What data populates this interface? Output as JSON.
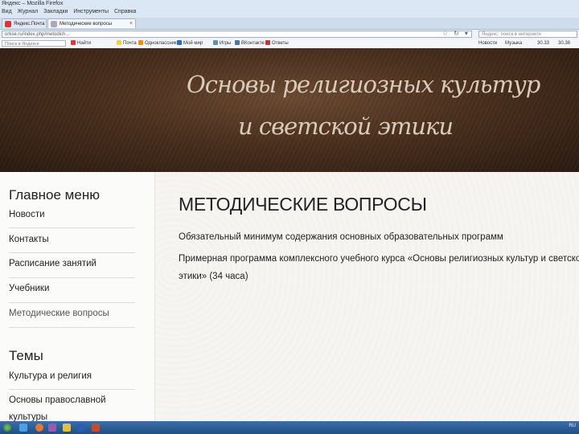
{
  "browser": {
    "window_title": "Яндекс – Mozilla Firefox",
    "menu": [
      "Вид",
      "Журнал",
      "Закладки",
      "Инструменты",
      "Справка"
    ],
    "tabs": [
      {
        "label": "Яндекс.Почта",
        "icon": "yandex-mail-icon",
        "active": false
      },
      {
        "label": "Методические вопросы",
        "icon": "page-icon",
        "active": true
      }
    ],
    "new_tab_label": "+",
    "url": "orkse.ru/index.php/metodich...",
    "search_placeholder": "Яндекс: поиск в интернете",
    "bookmarks": [
      {
        "label": "Найти",
        "icon": "search-icon"
      },
      {
        "label": "Почта",
        "icon": "mail-icon"
      },
      {
        "label": "Одноклассники",
        "icon": "odnoklassniki-icon"
      },
      {
        "label": "Мой мир",
        "icon": "moi-mir-icon"
      },
      {
        "label": "Игры",
        "icon": "games-icon"
      },
      {
        "label": "ВКонтакте",
        "icon": "vk-icon"
      },
      {
        "label": "Ответы",
        "icon": "answers-icon"
      }
    ],
    "yandex_search_placeholder": "Поиск в Яндексе",
    "right_toolbar": [
      "Новости",
      "Музыка",
      "30.33",
      "30.38"
    ],
    "accent": "#3b6fa8"
  },
  "banner": {
    "line1": "Основы религиозных культур",
    "line2": "и светской этики",
    "colors": {
      "bg_dark": "#2a1a10",
      "bg_light": "#6b4a32",
      "text": "#d9cbb8"
    }
  },
  "sidebar": {
    "main_menu_heading": "Главное меню",
    "main_menu_items": [
      {
        "label": "Новости",
        "active": false
      },
      {
        "label": "Контакты",
        "active": false
      },
      {
        "label": "Расписание занятий",
        "active": false
      },
      {
        "label": "Учебники",
        "active": false
      },
      {
        "label": "Методические вопросы",
        "active": true
      }
    ],
    "topics_heading": "Темы",
    "topics_items": [
      {
        "label": "Культура и религия"
      },
      {
        "label": "Основы православной"
      },
      {
        "label": "культуры"
      }
    ]
  },
  "main": {
    "title": "МЕТОДИЧЕСКИЕ ВОПРОСЫ",
    "links": [
      "Обязательный минимум содержания основных образовательных программ",
      "Примерная программа комплексного учебного курса «Основы религиозных культур и светской",
      "этики» (34 часа)"
    ]
  },
  "taskbar": {
    "apps": [
      "start-icon",
      "explorer-icon",
      "firefox-icon",
      "media-icon",
      "folder-icon",
      "word-icon",
      "powerpoint-icon"
    ],
    "tray_text": "RU"
  }
}
